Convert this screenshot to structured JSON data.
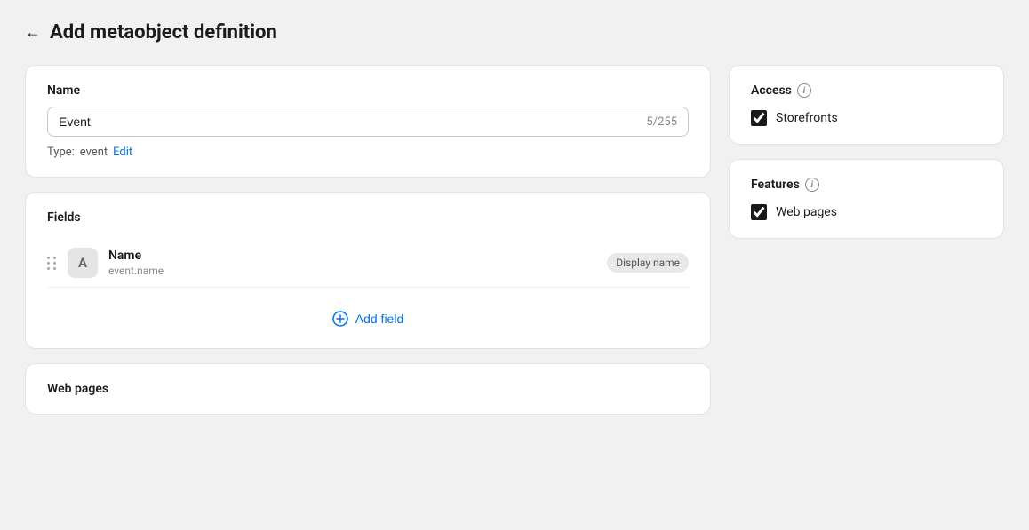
{
  "header": {
    "back_label": "←",
    "title": "Add metaobject definition"
  },
  "name_section": {
    "label": "Name",
    "input_value": "Event",
    "char_count": "5/255",
    "type_label": "Type:",
    "type_value": "event",
    "edit_label": "Edit"
  },
  "fields_section": {
    "title": "Fields",
    "fields": [
      {
        "icon": "A",
        "name": "Name",
        "key": "event.name",
        "badge": "Display name"
      }
    ],
    "add_field_label": "Add field"
  },
  "web_pages_section": {
    "title": "Web pages"
  },
  "access_section": {
    "title": "Access",
    "info": "i",
    "checkboxes": [
      {
        "label": "Storefronts",
        "checked": true
      }
    ]
  },
  "features_section": {
    "title": "Features",
    "info": "i",
    "checkboxes": [
      {
        "label": "Web pages",
        "checked": true
      }
    ]
  },
  "colors": {
    "accent": "#0070f3",
    "checkbox_dark": "#1a1a1a"
  }
}
